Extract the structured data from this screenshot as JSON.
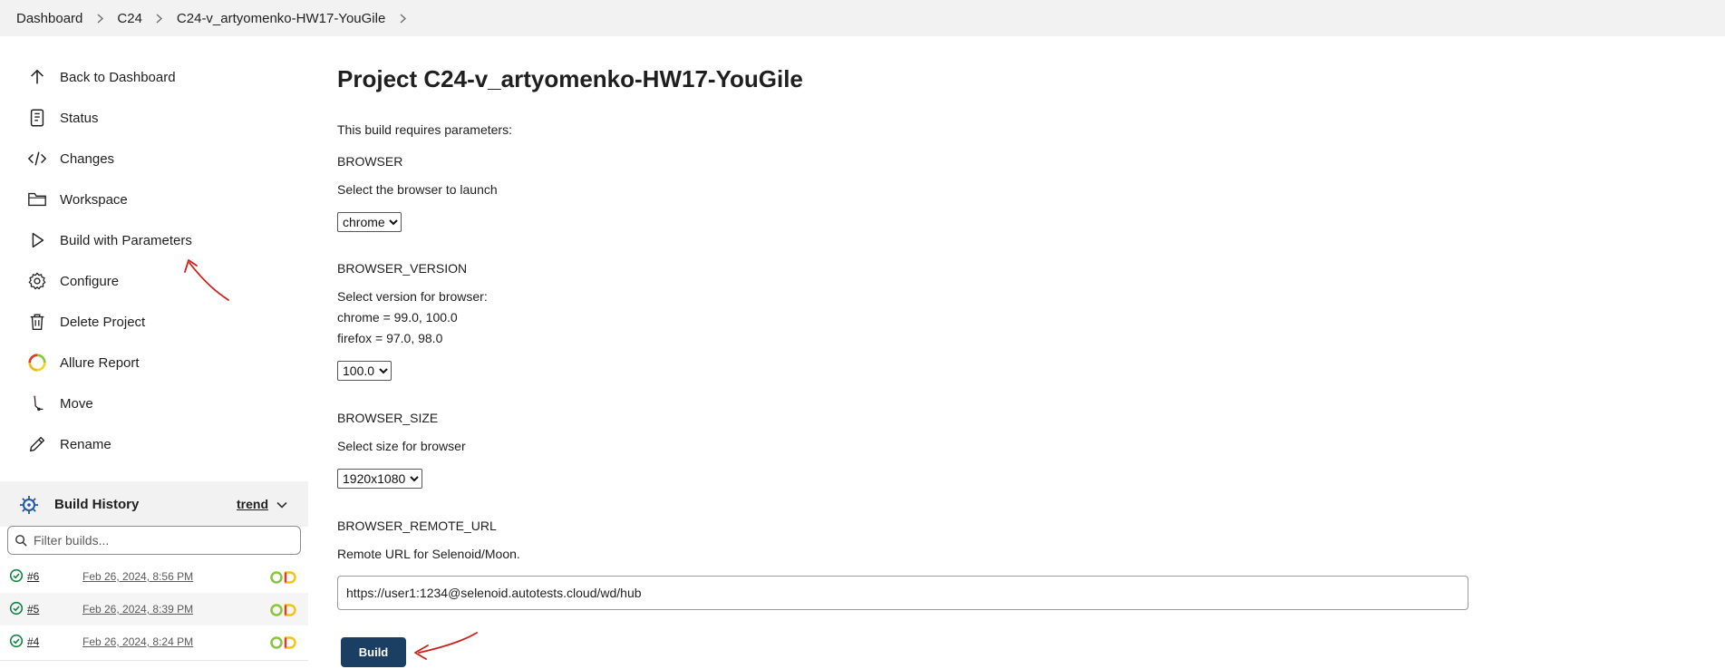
{
  "breadcrumb": {
    "items": [
      "Dashboard",
      "C24",
      "C24-v_artyomenko-HW17-YouGile"
    ]
  },
  "sidebar": {
    "tasks": [
      {
        "label": "Back to Dashboard",
        "icon": "arrow-up-icon"
      },
      {
        "label": "Status",
        "icon": "document-icon"
      },
      {
        "label": "Changes",
        "icon": "code-icon"
      },
      {
        "label": "Workspace",
        "icon": "folder-icon"
      },
      {
        "label": "Build with Parameters",
        "icon": "play-icon"
      },
      {
        "label": "Configure",
        "icon": "gear-icon"
      },
      {
        "label": "Delete Project",
        "icon": "trash-icon"
      },
      {
        "label": "Allure Report",
        "icon": "allure-icon"
      },
      {
        "label": "Move",
        "icon": "move-icon"
      },
      {
        "label": "Rename",
        "icon": "pencil-icon"
      }
    ],
    "history": {
      "title": "Build History",
      "trend_label": "trend",
      "filter_placeholder": "Filter builds...",
      "builds": [
        {
          "number": "#6",
          "date": "Feb 26, 2024, 8:56 PM",
          "status": "success"
        },
        {
          "number": "#5",
          "date": "Feb 26, 2024, 8:39 PM",
          "status": "success"
        },
        {
          "number": "#4",
          "date": "Feb 26, 2024, 8:24 PM",
          "status": "success"
        }
      ]
    }
  },
  "main": {
    "title": "Project C24-v_artyomenko-HW17-YouGile",
    "intro": "This build requires parameters:",
    "params": {
      "browser": {
        "name": "BROWSER",
        "description": "Select the browser to launch",
        "value": "chrome"
      },
      "browser_version": {
        "name": "BROWSER_VERSION",
        "description_lines": [
          "Select version for browser:",
          "chrome = 99.0, 100.0",
          "firefox = 97.0, 98.0"
        ],
        "value": "100.0"
      },
      "browser_size": {
        "name": "BROWSER_SIZE",
        "description": "Select size for browser",
        "value": "1920x1080"
      },
      "browser_remote_url": {
        "name": "BROWSER_REMOTE_URL",
        "description": "Remote URL for Selenoid/Moon.",
        "value": "https://user1:1234@selenoid.autotests.cloud/wd/hub"
      }
    },
    "build_button": "Build"
  },
  "colors": {
    "build_button": "#1a3f63",
    "success": "#138347",
    "annotation": "#d0201a",
    "header_bg": "#f2f2f2"
  }
}
